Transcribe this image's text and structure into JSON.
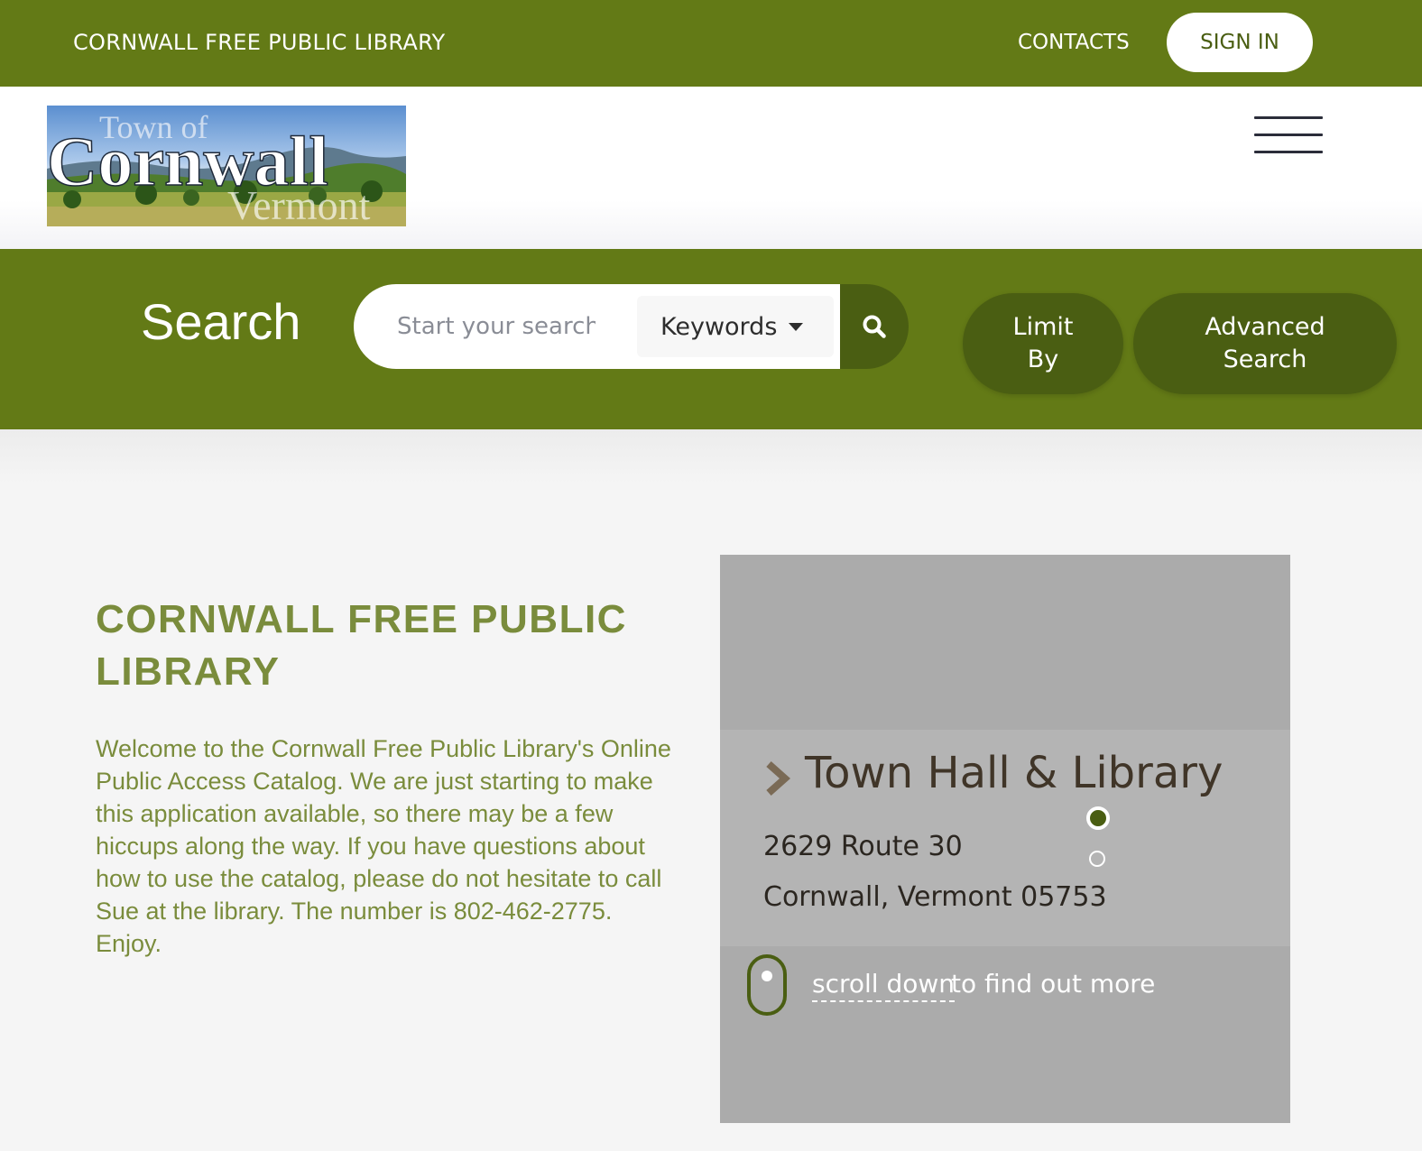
{
  "topbar": {
    "library_name": "CORNWALL FREE PUBLIC LIBRARY",
    "contacts": "CONTACTS",
    "sign_in": "SIGN IN"
  },
  "logo": {
    "line1": "Town of",
    "line2": "Cornwall",
    "line3": "Vermont"
  },
  "search": {
    "title": "Search",
    "placeholder": "Start your search",
    "type_selected": "Keywords",
    "limit_line1": "Limit",
    "limit_line2": "By",
    "advanced_line1": "Advanced",
    "advanced_line2": "Search"
  },
  "welcome": {
    "title": "CORNWALL FREE PUBLIC LIBRARY",
    "body": "Welcome to the Cornwall Free Public Library's Online Public Access Catalog. We are just starting to make this application available, so there may be a few hiccups along the way. If you have questions about how to use the catalog, please do not hesitate to call Sue at the library. The number is 802-462-2775. Enjoy."
  },
  "slide": {
    "heading": "Town Hall & Library",
    "address_line1": "2629 Route 30",
    "address_line2": "Cornwall, Vermont 05753",
    "scroll_link": "scroll down",
    "scroll_rest": "to find out more"
  },
  "colors": {
    "brand_green": "#637a16",
    "dark_green": "#4a5e12",
    "text_green": "#7a8c3c"
  },
  "icons": [
    "search-icon",
    "chevron-right-icon",
    "caret-down-icon",
    "hamburger-menu-icon",
    "mouse-scroll-icon"
  ]
}
